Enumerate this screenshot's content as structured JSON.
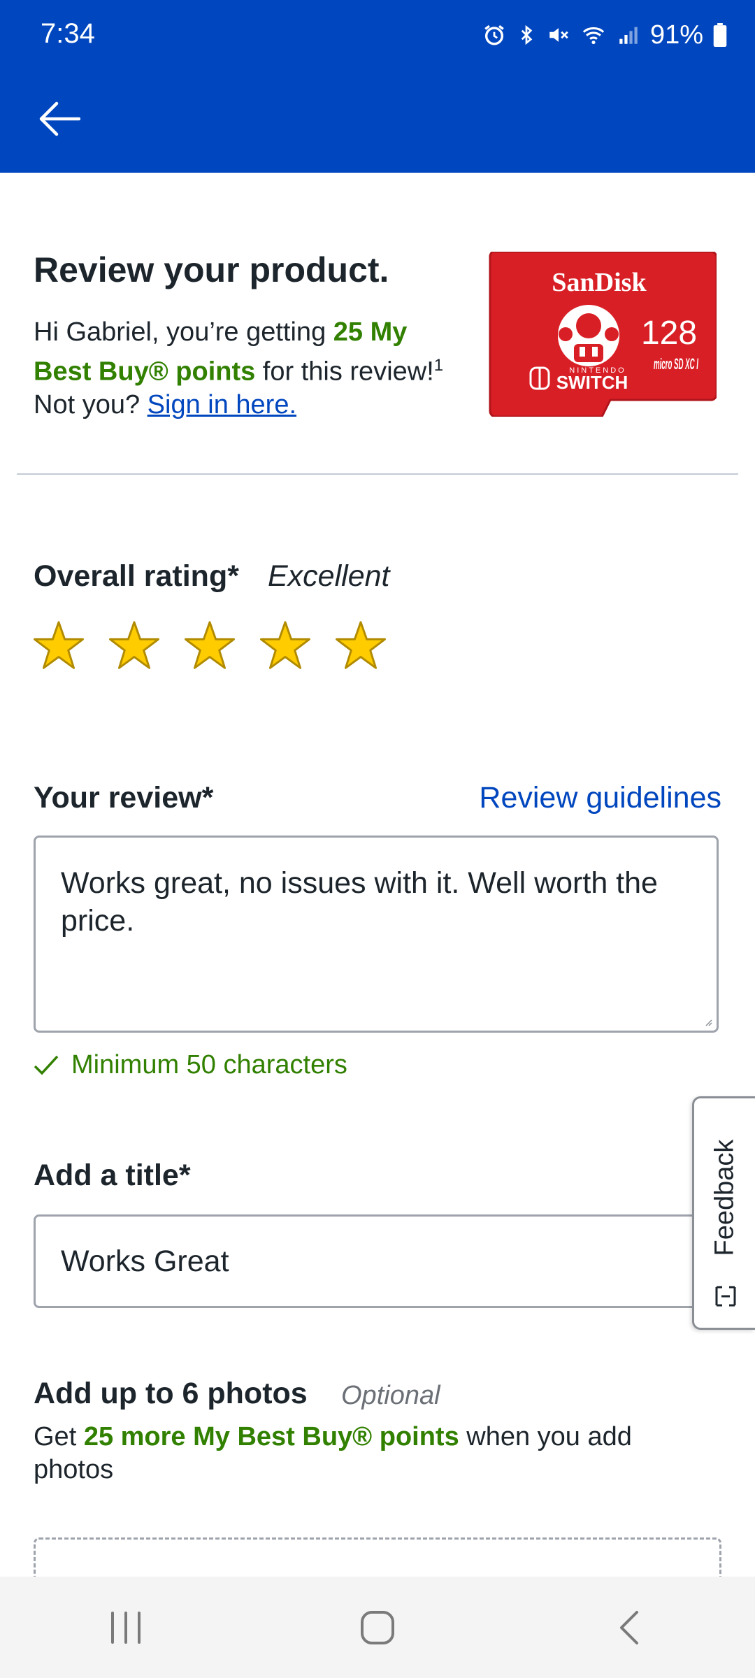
{
  "status_bar": {
    "time": "7:34",
    "battery": "91%"
  },
  "header": {
    "back_icon": "arrow-left-icon",
    "background": "#0046be"
  },
  "product": {
    "heading": "Review your product.",
    "greeting_prefix": "Hi Gabriel, you’re getting ",
    "points_highlight": "25 My Best Buy® points",
    "greeting_suffix": " for this review!",
    "footnote": "1",
    "not_you": "Not you? ",
    "sign_in_link": "Sign in here.",
    "image": {
      "brand": "SanDisk",
      "capacity": "128",
      "platform": "SWITCH",
      "platform_small": "NINTENDO",
      "format": "micro SD XC I"
    }
  },
  "rating": {
    "label": "Overall rating*",
    "value_text": "Excellent",
    "stars": 5,
    "max_stars": 5,
    "star_color": "#ffcc00"
  },
  "review": {
    "label": "Your review*",
    "guidelines_link": "Review guidelines",
    "text": "Works great, no issues with it. Well worth the price.",
    "min_note": "Minimum 50 characters"
  },
  "title_field": {
    "label": "Add a title*",
    "value": "Works Great"
  },
  "photos": {
    "label": "Add up to 6 photos",
    "optional": "Optional",
    "desc_prefix": "Get ",
    "desc_highlight": "25 more My Best Buy® points",
    "desc_suffix": " when you add photos"
  },
  "feedback_tab": {
    "label": "Feedback"
  },
  "colors": {
    "brand_blue": "#0046be",
    "green": "#318000",
    "link_blue": "#0046be"
  }
}
